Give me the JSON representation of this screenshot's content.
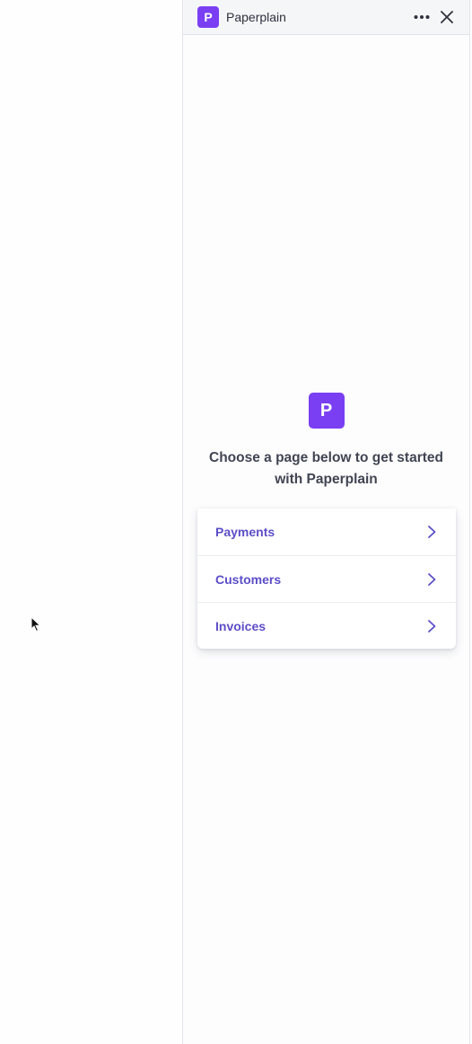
{
  "app": {
    "name": "Paperplain",
    "badge_letter": "P",
    "brand_color": "#7a3ff2"
  },
  "header": {
    "more_icon": "ellipsis-icon",
    "close_icon": "close-icon"
  },
  "hero": {
    "badge_letter": "P",
    "message": "Choose a page below to get started with Paperplain"
  },
  "nav": {
    "items": [
      {
        "label": "Payments",
        "icon": "chevron-right-icon"
      },
      {
        "label": "Customers",
        "icon": "chevron-right-icon"
      },
      {
        "label": "Invoices",
        "icon": "chevron-right-icon"
      }
    ]
  }
}
